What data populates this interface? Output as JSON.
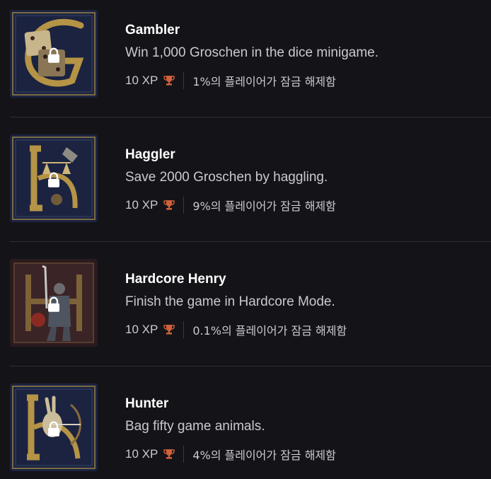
{
  "achievements": [
    {
      "title": "Gambler",
      "description": "Win 1,000 Groschen in the dice minigame.",
      "xp": "10 XP",
      "unlock_rate": "1%의 플레이어가 잠금 해제함",
      "icon": "dice-illuminated-letter-g-icon",
      "locked": true
    },
    {
      "title": "Haggler",
      "description": "Save 2000 Groschen by haggling.",
      "xp": "10 XP",
      "unlock_rate": "9%의 플레이어가 잠금 해제함",
      "icon": "scales-illuminated-letter-h-icon",
      "locked": true
    },
    {
      "title": "Hardcore Henry",
      "description": "Finish the game in Hardcore Mode.",
      "xp": "10 XP",
      "unlock_rate": "0.1%의 플레이어가 잠금 해제함",
      "icon": "knight-illuminated-letter-h-icon",
      "locked": true
    },
    {
      "title": "Hunter",
      "description": "Bag fifty game animals.",
      "xp": "10 XP",
      "unlock_rate": "4%의 플레이어가 잠금 해제함",
      "icon": "hare-archer-illuminated-letter-h-icon",
      "locked": true
    }
  ],
  "colors": {
    "background": "#141418",
    "trophy": "#d2603a",
    "divider": "#2d2d33"
  }
}
